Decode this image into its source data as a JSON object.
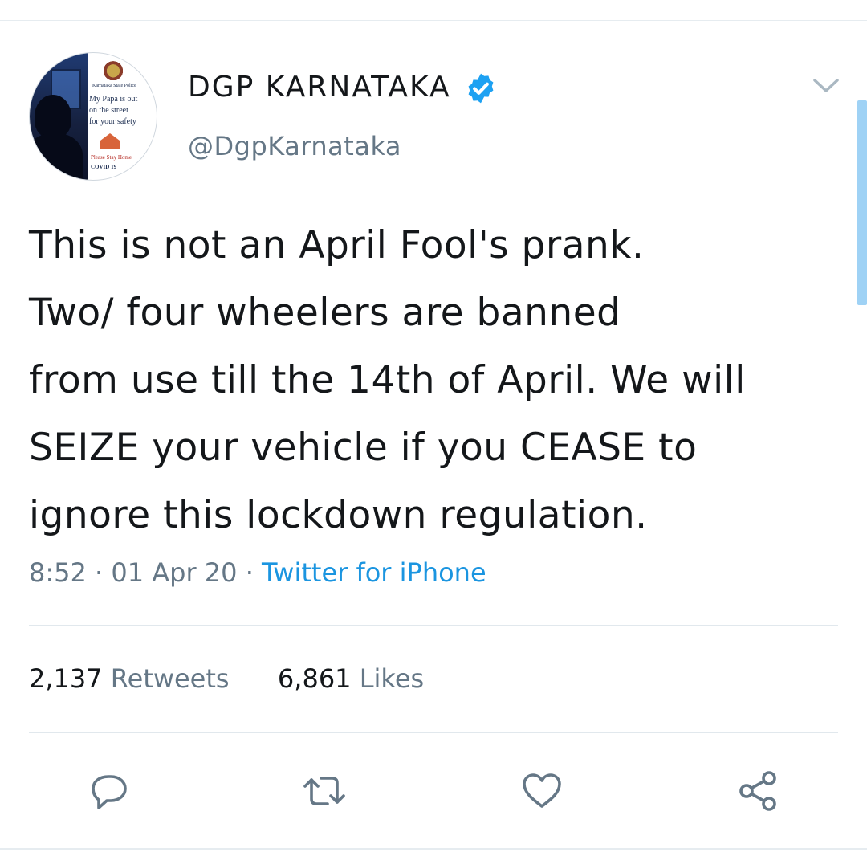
{
  "author": {
    "name": "DGP KARNATAKA",
    "handle": "@DgpKarnataka",
    "verified": true,
    "avatar_text": {
      "org": "Karnataka State Police",
      "line1": "My Papa is out",
      "line2": "on the street",
      "line3": "for your safety",
      "footer1": "Please Stay Home",
      "footer2": "COVID 19"
    }
  },
  "tweet": {
    "lines": [
      "This is not an April Fool's prank.",
      "Two/ four wheelers are banned",
      "from use till the 14th of April. We will",
      "SEIZE your vehicle if you CEASE to",
      "ignore this lockdown regulation."
    ],
    "time": "8:52",
    "date": "01 Apr 20",
    "separator": "·",
    "source": "Twitter for iPhone"
  },
  "stats": {
    "retweets_count": "2,137",
    "retweets_label": "Retweets",
    "likes_count": "6,861",
    "likes_label": "Likes"
  },
  "actions": {
    "reply_icon": "reply-icon",
    "retweet_icon": "retweet-icon",
    "like_icon": "heart-icon",
    "share_icon": "share-icon"
  },
  "colors": {
    "text": "#14171a",
    "secondary": "#657786",
    "link": "#1b95e0",
    "verified": "#1da1f2",
    "divider": "#e1e8ed"
  }
}
